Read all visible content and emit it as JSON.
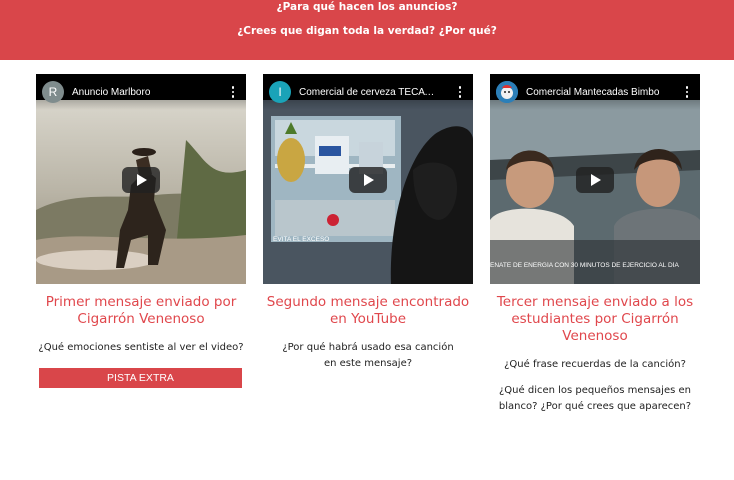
{
  "banner": {
    "question_1": "¿Para qué hacen los anuncios?",
    "question_2": "¿Crees que digan toda la verdad? ¿Por qué?"
  },
  "cards": [
    {
      "video": {
        "avatar_letter": "R",
        "avatar_color": "#7f8c8d",
        "title": "Anuncio Marlboro"
      },
      "title": "Primer mensaje enviado por Cigarrón Venenoso",
      "questions": [
        "¿Qué emociones sentiste al ver el video?"
      ],
      "button_label": "PISTA EXTRA"
    },
    {
      "video": {
        "avatar_letter": "I",
        "avatar_color": "#1aa3b8",
        "title": "Comercial de cerveza TECATE.",
        "caption": "EVITA EL EXCESO"
      },
      "title": "Segundo mensaje encontrado en YouTube",
      "questions": [
        "¿Por qué habrá usado esa canción en este mensaje?"
      ]
    },
    {
      "video": {
        "avatar_letter": "",
        "avatar_color": "#2c7fb8",
        "title": "Comercial Mantecadas Bimbo",
        "caption": "ÉNATE DE ENERGÍA CON 30 MINUTOS DE EJERCICIO AL DÍA"
      },
      "title": "Tercer mensaje enviado a los estudiantes por Cigarrón Venenoso",
      "questions": [
        "¿Qué frase recuerdas de la canción?",
        "¿Qué dicen los pequeños mensajes en blanco? ¿Por qué crees que aparecen?"
      ]
    }
  ],
  "colors": {
    "accent": "#d9464a",
    "title_red": "#e0474c"
  }
}
